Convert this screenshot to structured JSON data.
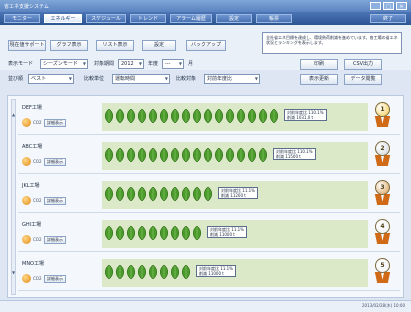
{
  "window": {
    "title": "省エネ支援システム",
    "min_label": "_",
    "max_label": "□",
    "close_label": "✕"
  },
  "menu": {
    "items": [
      "モニター",
      "エネルギー",
      "スケジュール",
      "トレンド",
      "アラーム履歴",
      "設定",
      "帳票"
    ],
    "active_index": 1,
    "exit_label": "終了"
  },
  "subtabs": {
    "items": [
      "現在値サポート",
      "グラフ表示",
      "リスト表示",
      "設定"
    ],
    "active_index": 1,
    "backup_label": "バックアップ",
    "note": "全社省エネ目標を達成し、環境負荷削減を進めています。各工場の省エネ状況とランキングを表示します。"
  },
  "controls": {
    "display_mode_label": "表示モード",
    "display_mode_value": "シーズンモード",
    "target_period_label": "対象期間",
    "year_value": "2012",
    "year_unit": "年度",
    "month_value": "---",
    "month_unit": "月",
    "order_label": "並び順",
    "order_value": "ベスト",
    "period_unit_label": "比較単位",
    "period_unit_value": "運転時間",
    "compare_label": "比較対象",
    "compare_value": "対前年度比",
    "print_label": "印刷",
    "csv_label": "CSV出力",
    "refresh_label": "表示更新",
    "data_label": "データ閲覧"
  },
  "detail_label": "詳細表示",
  "co2_label": "CO2",
  "factories": [
    {
      "name": "DEF工場",
      "leaves": 16,
      "ratio": "対前年度比 110.1%",
      "reduction": "削減 1031,0 t",
      "rank": "1",
      "medal_color": "#f2c94c"
    },
    {
      "name": "ABC工場",
      "leaves": 15,
      "ratio": "対前年度比 110.1%",
      "reduction": "削減 11500 t",
      "rank": "2",
      "medal_color": "#cfd6de"
    },
    {
      "name": "JKL工場",
      "leaves": 10,
      "ratio": "対前年度比 11.1%",
      "reduction": "削減 11200 t",
      "rank": "3",
      "medal_color": "#d79a52"
    },
    {
      "name": "GHI工場",
      "leaves": 9,
      "ratio": "対前年度比 11.1%",
      "reduction": "削減 11000 t",
      "rank": "4",
      "medal_color": "#eef1f4"
    },
    {
      "name": "MNO工場",
      "leaves": 8,
      "ratio": "対前年度比 11.1%",
      "reduction": "削減 11000 t",
      "rank": "5",
      "medal_color": "#eef1f4"
    }
  ],
  "status": {
    "datetime": "2013/02/28(木) 10:00"
  }
}
